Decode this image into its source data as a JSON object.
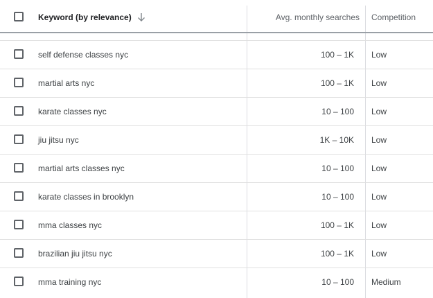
{
  "header": {
    "keyword_label": "Keyword (by relevance)",
    "searches_label": "Avg. monthly searches",
    "competition_label": "Competition",
    "sort_icon": "arrow-down-icon"
  },
  "rows": [
    {
      "keyword": "self defense classes nyc",
      "searches": "100 – 1K",
      "competition": "Low"
    },
    {
      "keyword": "martial arts nyc",
      "searches": "100 – 1K",
      "competition": "Low"
    },
    {
      "keyword": "karate classes nyc",
      "searches": "10 – 100",
      "competition": "Low"
    },
    {
      "keyword": "jiu jitsu nyc",
      "searches": "1K – 10K",
      "competition": "Low"
    },
    {
      "keyword": "martial arts classes nyc",
      "searches": "10 – 100",
      "competition": "Low"
    },
    {
      "keyword": "karate classes in brooklyn",
      "searches": "10 – 100",
      "competition": "Low"
    },
    {
      "keyword": "mma classes nyc",
      "searches": "100 – 1K",
      "competition": "Low"
    },
    {
      "keyword": "brazilian jiu jitsu nyc",
      "searches": "100 – 1K",
      "competition": "Low"
    },
    {
      "keyword": "mma training nyc",
      "searches": "10 – 100",
      "competition": "Medium"
    }
  ]
}
